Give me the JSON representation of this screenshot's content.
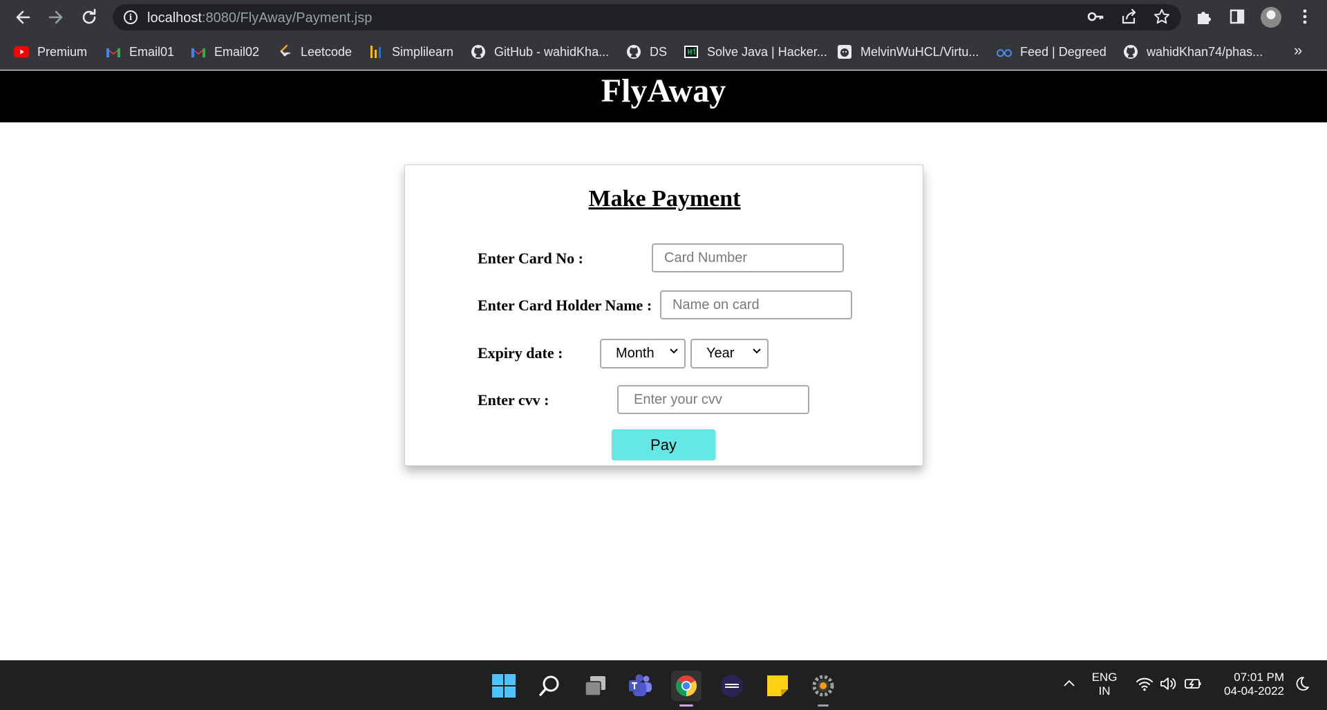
{
  "browser": {
    "url_host": "localhost",
    "url_path": ":8080/FlyAway/Payment.jsp",
    "bookmarks": [
      {
        "label": "Premium",
        "icon": "youtube-icon"
      },
      {
        "label": "Email01",
        "icon": "gmail-icon"
      },
      {
        "label": "Email02",
        "icon": "gmail-icon"
      },
      {
        "label": "Leetcode",
        "icon": "leetcode-icon"
      },
      {
        "label": "Simplilearn",
        "icon": "simplilearn-icon"
      },
      {
        "label": "GitHub - wahidKha...",
        "icon": "github-icon"
      },
      {
        "label": "DS",
        "icon": "github-icon"
      },
      {
        "label": "Solve Java | Hacker...",
        "icon": "hackerrank-icon"
      },
      {
        "label": "MelvinWuHCL/Virtu...",
        "icon": "github-octocat-icon"
      },
      {
        "label": "Feed | Degreed",
        "icon": "degreed-icon"
      },
      {
        "label": "wahidKhan74/phas...",
        "icon": "github-icon"
      }
    ],
    "more_bookmarks": "»"
  },
  "site": {
    "title": "FlyAway"
  },
  "payment": {
    "heading": "Make Payment",
    "card_no_label": "Enter Card No :",
    "card_no_placeholder": "Card Number",
    "card_holder_label": "Enter Card Holder Name :",
    "card_holder_placeholder": "Name on card",
    "expiry_label": "Expiry date :",
    "month_selected": "Month",
    "year_selected": "Year",
    "cvv_label": "Enter cvv :",
    "cvv_placeholder": "Enter your cvv",
    "pay_label": "Pay",
    "pay_color": "#66e7e7"
  },
  "taskbar": {
    "apps": [
      "windows-start-icon",
      "search-icon",
      "task-view-icon",
      "teams-icon",
      "chrome-icon",
      "eclipse-icon",
      "sticky-notes-icon",
      "settings-icon"
    ],
    "language_line1": "ENG",
    "language_line2": "IN",
    "time": "07:01 PM",
    "date": "04-04-2022"
  }
}
